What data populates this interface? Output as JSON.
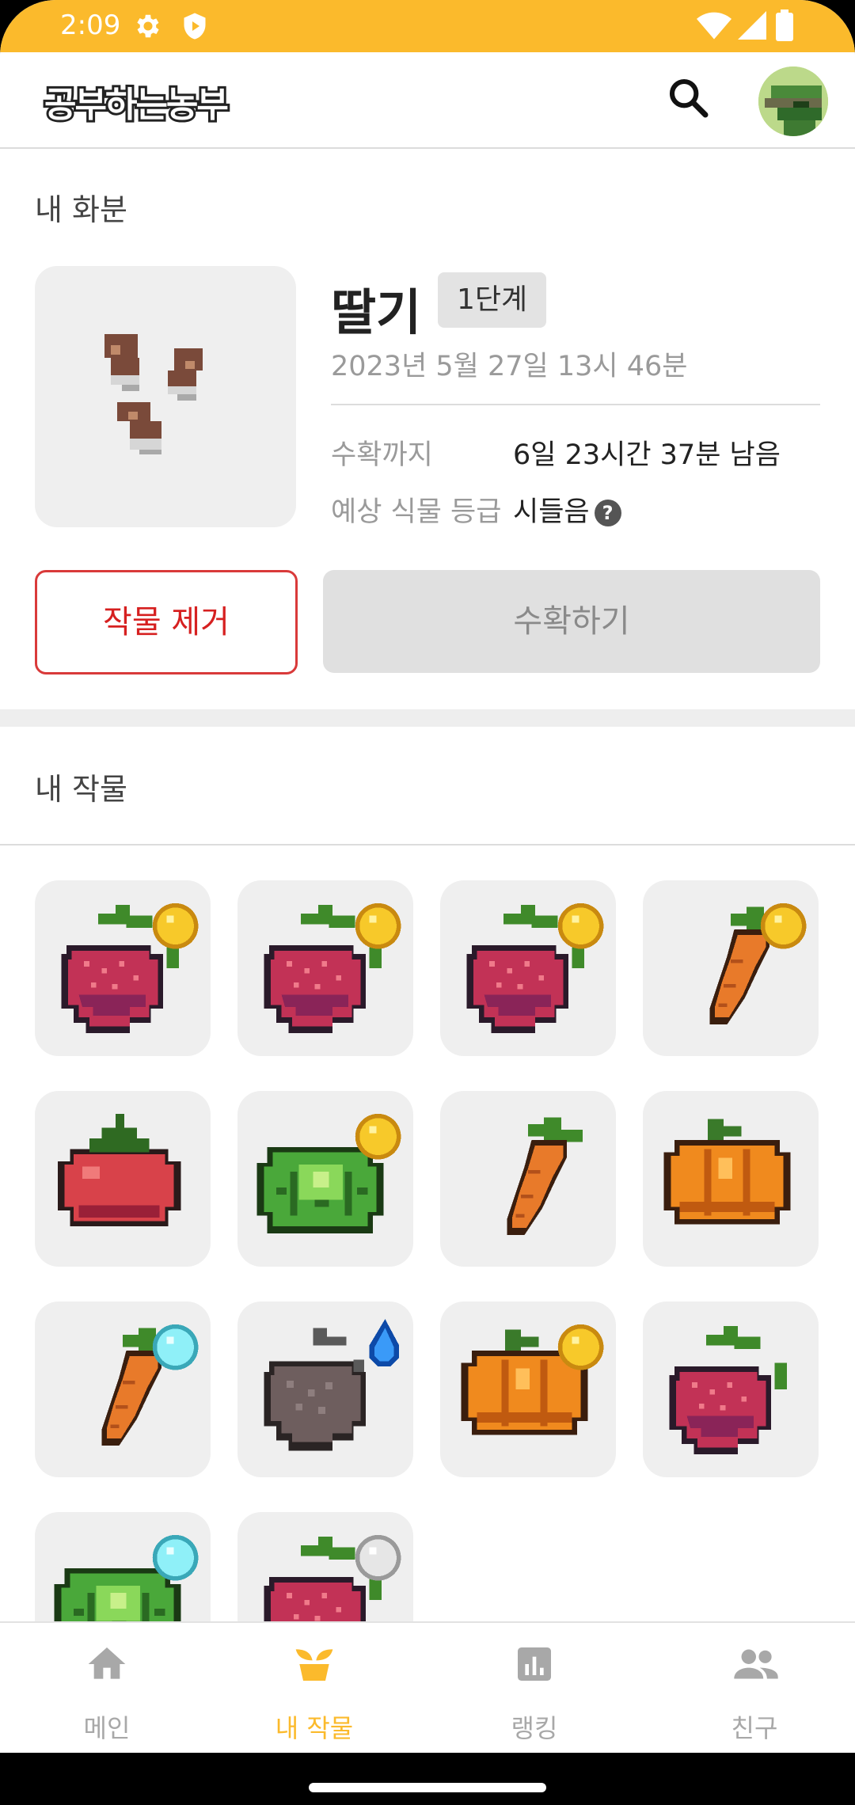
{
  "status_bar": {
    "time": "2:09"
  },
  "app": {
    "title": "공부하는농부"
  },
  "pot": {
    "section_title": "내 화분",
    "plant_name": "딸기",
    "stage": "1단계",
    "planted_at": "2023년 5월 27일 13시 46분",
    "harvest_label": "수확까지",
    "harvest_value": "6일 23시간 37분 남음",
    "grade_label": "예상 식물 등급",
    "grade_value": "시들음",
    "help_symbol": "?",
    "remove_button": "작물 제거",
    "harvest_button": "수확하기"
  },
  "crops": {
    "section_title": "내 작물",
    "items": [
      {
        "crop": "strawberry",
        "gem": "gold"
      },
      {
        "crop": "strawberry",
        "gem": "gold"
      },
      {
        "crop": "strawberry",
        "gem": "gold"
      },
      {
        "crop": "carrot",
        "gem": "gold"
      },
      {
        "crop": "tomato",
        "gem": "none"
      },
      {
        "crop": "cabbage",
        "gem": "gold"
      },
      {
        "crop": "carrot",
        "gem": "none"
      },
      {
        "crop": "pumpkin",
        "gem": "none"
      },
      {
        "crop": "carrot",
        "gem": "cyan"
      },
      {
        "crop": "wilted",
        "gem": "blue-drop"
      },
      {
        "crop": "pumpkin",
        "gem": "gold"
      },
      {
        "crop": "strawberry",
        "gem": "none"
      },
      {
        "crop": "cabbage",
        "gem": "cyan"
      },
      {
        "crop": "strawberry",
        "gem": "silver"
      }
    ]
  },
  "bottom_nav": {
    "items": [
      {
        "label": "메인",
        "icon": "home-icon"
      },
      {
        "label": "내 작물",
        "icon": "sprout-icon",
        "active": true
      },
      {
        "label": "랭킹",
        "icon": "chart-icon"
      },
      {
        "label": "친구",
        "icon": "people-icon"
      }
    ]
  },
  "colors": {
    "accent": "#FBBA2C",
    "danger": "#D62020",
    "tile_bg": "#EFEFEF"
  }
}
